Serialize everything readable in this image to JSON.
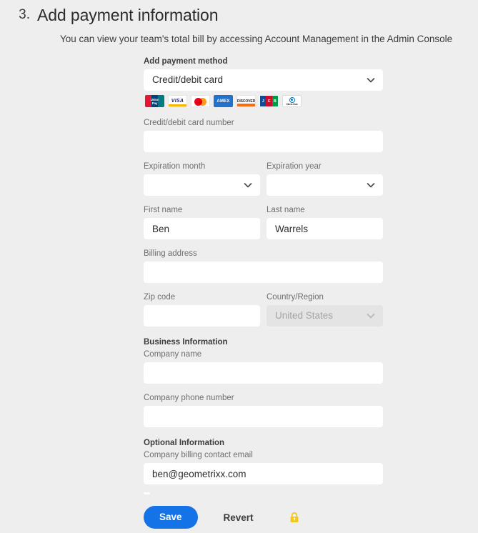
{
  "header": {
    "step_number": "3.",
    "title": "Add payment information",
    "subtitle": "You can view your team's total bill by accessing Account Management in the Admin Console"
  },
  "form": {
    "payment_method": {
      "label": "Add payment method",
      "value": "Credit/debit card",
      "chevron_icon": "chevron-down-icon"
    },
    "accepted_cards": [
      {
        "name": "unionpay",
        "label": "UnionPay"
      },
      {
        "name": "visa",
        "label": "VISA"
      },
      {
        "name": "mastercard",
        "label": "Mastercard"
      },
      {
        "name": "amex",
        "label": "AMEX"
      },
      {
        "name": "discover",
        "label": "DISCOVER"
      },
      {
        "name": "jcb",
        "label": "JCB"
      },
      {
        "name": "diners-club",
        "label": "Diners Club"
      }
    ],
    "card_number": {
      "label": "Credit/debit card number",
      "value": "",
      "placeholder": ""
    },
    "expiration_month": {
      "label": "Expiration month",
      "value": ""
    },
    "expiration_year": {
      "label": "Expiration year",
      "value": ""
    },
    "first_name": {
      "label": "First name",
      "value": "Ben"
    },
    "last_name": {
      "label": "Last name",
      "value": "Warrels"
    },
    "billing_address": {
      "label": "Billing address",
      "value": ""
    },
    "zip_code": {
      "label": "Zip code",
      "value": ""
    },
    "country_region": {
      "label": "Country/Region",
      "value": "United States",
      "disabled": true
    },
    "business_information": {
      "section_label": "Business Information",
      "company_name": {
        "label": "Company name",
        "value": ""
      },
      "company_phone": {
        "label": "Company phone number",
        "value": ""
      }
    },
    "optional_information": {
      "section_label": "Optional Information",
      "billing_contact_email": {
        "label": "Company billing contact email",
        "value": "ben@geometrixx.com"
      }
    }
  },
  "footer": {
    "save_label": "Save",
    "revert_label": "Revert",
    "lock_icon": "lock-icon"
  },
  "colors": {
    "page_background": "#eeeeee",
    "accent_blue": "#1473E6",
    "field_background": "#ffffff",
    "disabled_background": "#e4e4e4",
    "label_gray": "#6e6e6e",
    "lock_yellow": "#F5C518"
  }
}
